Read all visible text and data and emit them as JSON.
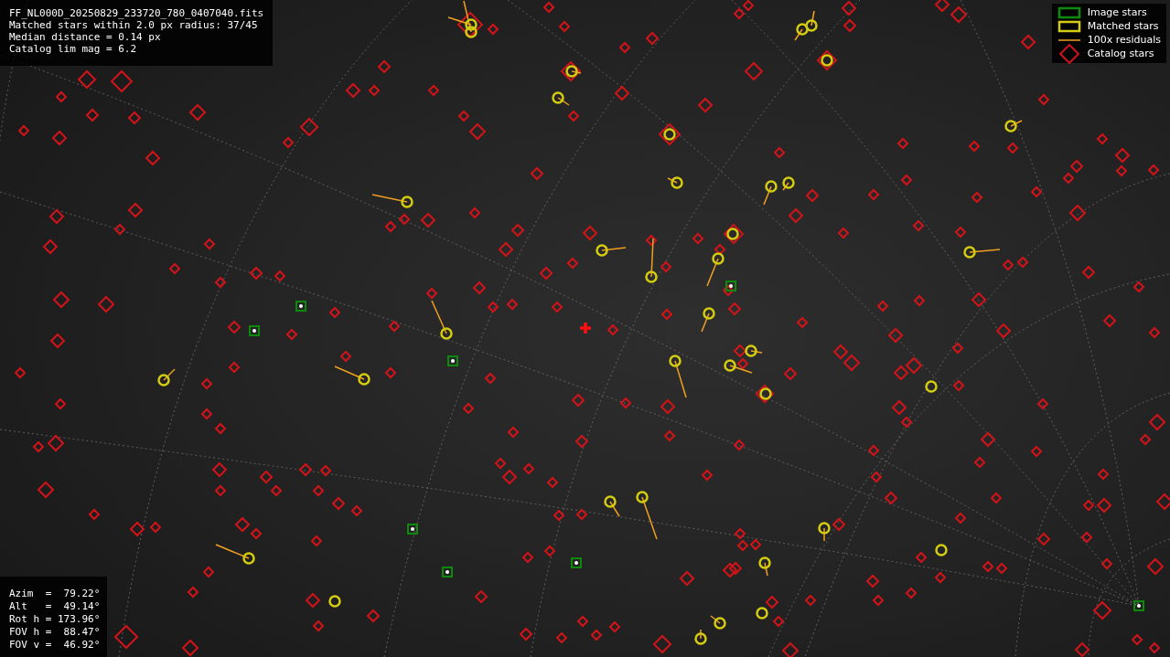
{
  "info_panel": {
    "lines": [
      "FF_NL000D_20250829_233720_780_0407040.fits",
      "Matched stars within 2.0 px radius: 37/45",
      "Median distance = 0.14 px",
      "Catalog lim mag = 6.2"
    ]
  },
  "legend": [
    {
      "kind": "image",
      "label": "Image stars"
    },
    {
      "kind": "matched",
      "label": "Matched stars"
    },
    {
      "kind": "residual",
      "label": "100x residuals"
    },
    {
      "kind": "catalog",
      "label": "Catalog stars"
    }
  ],
  "pointing_panel": {
    "lines": [
      "Azim  =  79.22°",
      "Alt   =  49.14°",
      "Rot h = 173.96°",
      "FOV h =  88.47°",
      "FOV v =  46.92°"
    ]
  }
}
